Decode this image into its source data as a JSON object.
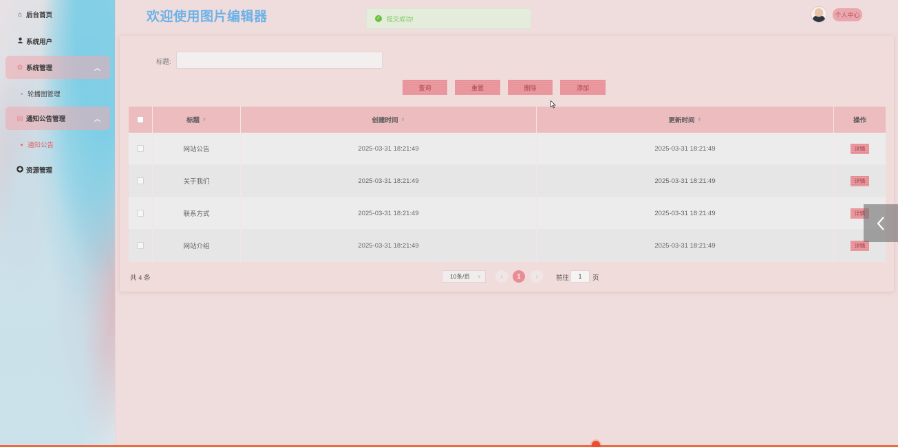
{
  "sidebar": {
    "items": [
      {
        "label": "后台首页",
        "icon": "home-icon"
      },
      {
        "label": "系统用户",
        "icon": "user-icon"
      },
      {
        "label": "系统管理",
        "icon": "gear-icon",
        "expanded": true
      },
      {
        "label": "轮播图管理"
      },
      {
        "label": "通知公告管理",
        "icon": "document-icon",
        "expanded": true
      },
      {
        "label": "通知公告",
        "active": true
      },
      {
        "label": "资源管理",
        "icon": "plus-circle-icon"
      }
    ]
  },
  "header": {
    "title": "欢迎使用图片编辑器",
    "toast": "提交成功!",
    "profile": "个人中心"
  },
  "search": {
    "label": "标题:",
    "value": ""
  },
  "buttons": {
    "query": "查询",
    "reset": "重置",
    "delete": "删除",
    "add": "添加"
  },
  "table": {
    "headers": {
      "title": "标题",
      "created": "创建时间",
      "updated": "更新时间",
      "ops": "操作"
    },
    "rows": [
      {
        "title": "网站公告",
        "created": "2025-03-31 18:21:49",
        "updated": "2025-03-31 18:21:49",
        "action": "详情"
      },
      {
        "title": "关于我们",
        "created": "2025-03-31 18:21:49",
        "updated": "2025-03-31 18:21:49",
        "action": "详情"
      },
      {
        "title": "联系方式",
        "created": "2025-03-31 18:21:49",
        "updated": "2025-03-31 18:21:49",
        "action": "详情"
      },
      {
        "title": "网站介绍",
        "created": "2025-03-31 18:21:49",
        "updated": "2025-03-31 18:21:49",
        "action": "详情"
      }
    ]
  },
  "pagination": {
    "total": "共 4 条",
    "page_size": "10条/页",
    "current_page": "1",
    "goto_label": "前往",
    "goto_value": "1",
    "goto_suffix": "页"
  },
  "colors": {
    "accent": "#e98d95",
    "title": "#6db2e8",
    "success": "#67c23a",
    "progress": "#f06a3f"
  }
}
